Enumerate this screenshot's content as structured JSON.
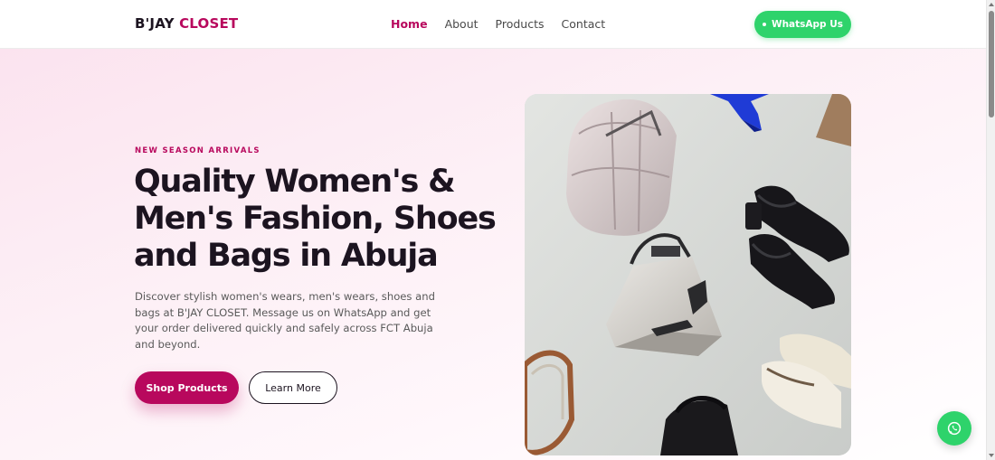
{
  "brand": {
    "part1": "B'JAY",
    "part2": "CLOSET"
  },
  "nav": [
    {
      "label": "Home",
      "active": true
    },
    {
      "label": "About",
      "active": false
    },
    {
      "label": "Products",
      "active": false
    },
    {
      "label": "Contact",
      "active": false
    }
  ],
  "header_cta": {
    "label": "WhatsApp Us"
  },
  "hero": {
    "eyebrow": "NEW SEASON ARRIVALS",
    "headline": "Quality Women's & Men's Fashion, Shoes and Bags in Abuja",
    "description": "Discover stylish women's wears, men's wears, shoes and bags at B'JAY CLOSET. Message us on WhatsApp and get your order delivered quickly and safely across FCT Abuja and beyond.",
    "primary_button": "Shop Products",
    "secondary_button": "Learn More"
  },
  "colors": {
    "accent": "#b8085d",
    "whatsapp": "#2ed36b",
    "text_dark": "#1c1420"
  },
  "icons": {
    "fab": "whatsapp-icon"
  }
}
